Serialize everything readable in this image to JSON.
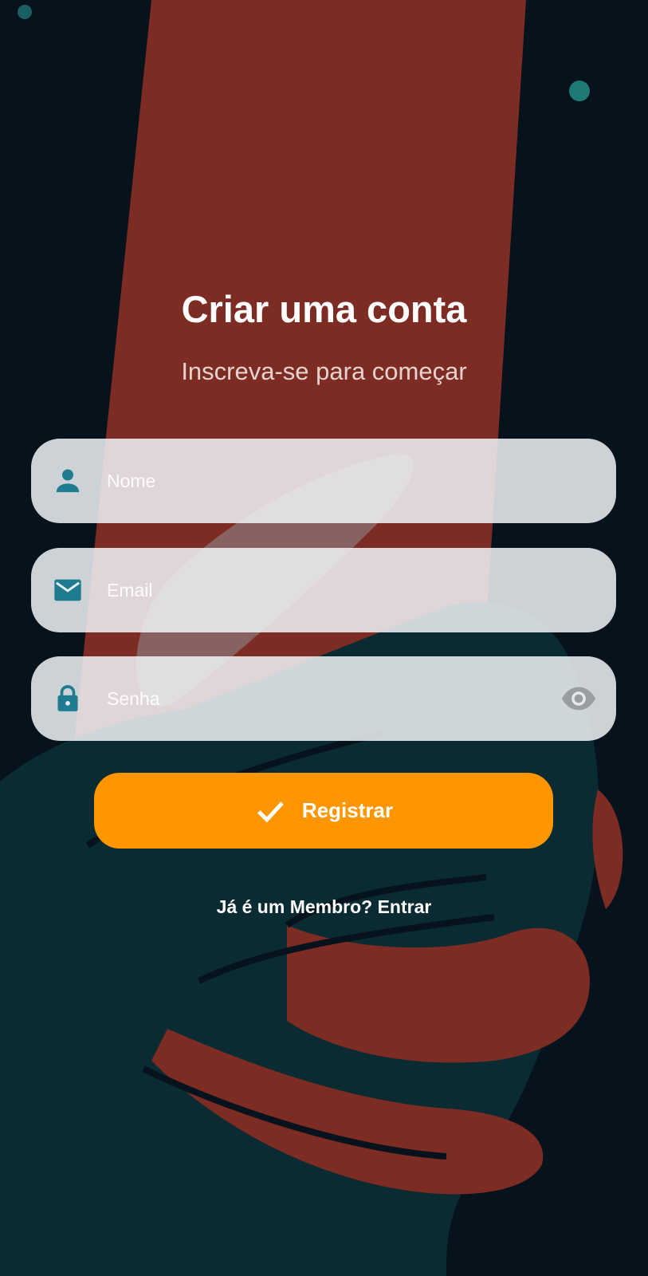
{
  "header": {
    "title": "Criar uma conta",
    "subtitle": "Inscreva-se para começar"
  },
  "form": {
    "name_field": {
      "placeholder": "Nome",
      "icon": "person-icon"
    },
    "email_field": {
      "placeholder": "Email",
      "icon": "mail-icon"
    },
    "password_field": {
      "placeholder": "Senha",
      "icon": "lock-icon",
      "toggle_icon": "eye-icon"
    },
    "submit": {
      "label": "Registrar",
      "icon": "check-icon"
    }
  },
  "footer": {
    "login_link": "Já é um Membro? Entrar"
  },
  "colors": {
    "background": "#06121c",
    "accent_button": "#ff9600",
    "field_icon": "#1f7b8f",
    "field_fill": "#f1f4f8"
  }
}
